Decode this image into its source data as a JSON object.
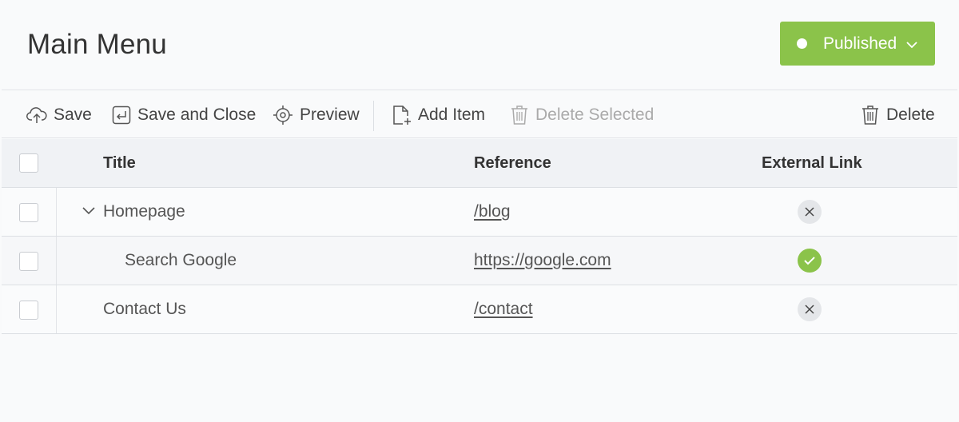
{
  "header": {
    "title": "Main Menu",
    "status": {
      "label": "Published",
      "color": "#8bc34a"
    }
  },
  "toolbar": {
    "save": "Save",
    "save_close": "Save and Close",
    "preview": "Preview",
    "add_item": "Add Item",
    "delete_selected": "Delete Selected",
    "delete": "Delete"
  },
  "table": {
    "columns": {
      "title": "Title",
      "reference": "Reference",
      "external": "External Link"
    },
    "rows": [
      {
        "title": "Homepage",
        "reference": "/blog",
        "external": false,
        "expanded": true
      },
      {
        "title": "Search Google",
        "reference": "https://google.com",
        "external": true
      },
      {
        "title": "Contact Us",
        "reference": "/contact",
        "external": false
      }
    ]
  }
}
